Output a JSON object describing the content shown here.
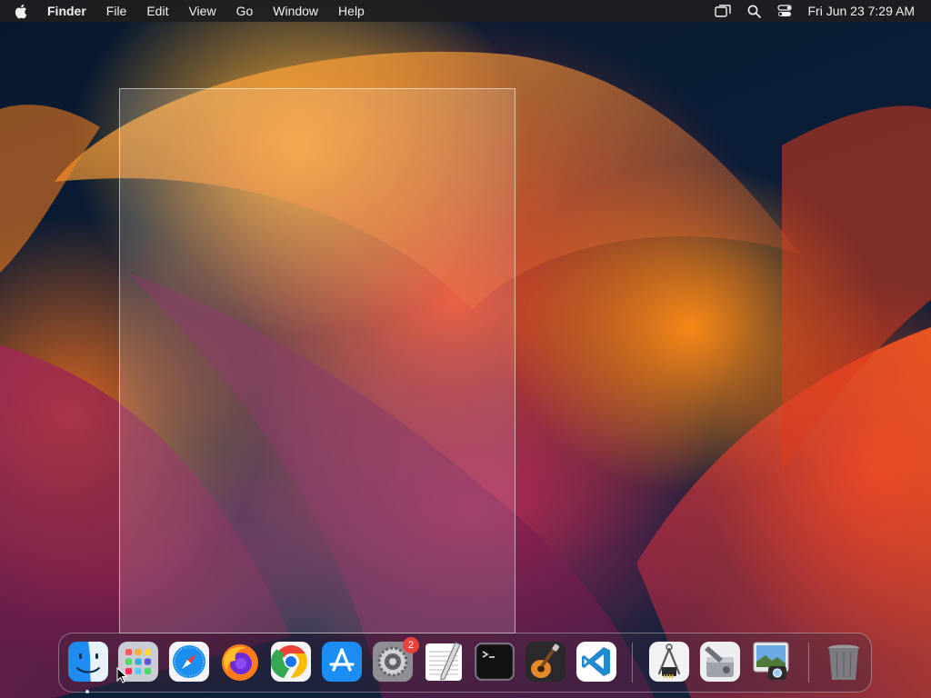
{
  "menubar": {
    "app_name": "Finder",
    "menus": [
      "File",
      "Edit",
      "View",
      "Go",
      "Window",
      "Help"
    ],
    "status_icons": [
      "screen-mirroring-icon",
      "spotlight-search-icon",
      "control-center-icon"
    ],
    "clock": "Fri Jun 23  7:29 AM"
  },
  "dock": {
    "items": [
      {
        "name": "finder",
        "running": true
      },
      {
        "name": "launchpad"
      },
      {
        "name": "safari"
      },
      {
        "name": "firefox"
      },
      {
        "name": "chrome"
      },
      {
        "name": "app-store"
      },
      {
        "name": "system-settings",
        "badge": "2"
      },
      {
        "name": "textedit"
      },
      {
        "name": "terminal"
      },
      {
        "name": "garageband"
      },
      {
        "name": "visual-studio-code"
      },
      {
        "name": "system-information"
      },
      {
        "name": "disk-utility"
      },
      {
        "name": "preview"
      },
      {
        "name": "trash"
      }
    ]
  },
  "colors": {
    "menubar_bg": "#1e1e20",
    "badge": "#e9423a",
    "finder_blue": "#1e8cf0",
    "vscode_blue": "#1f8ad2"
  }
}
